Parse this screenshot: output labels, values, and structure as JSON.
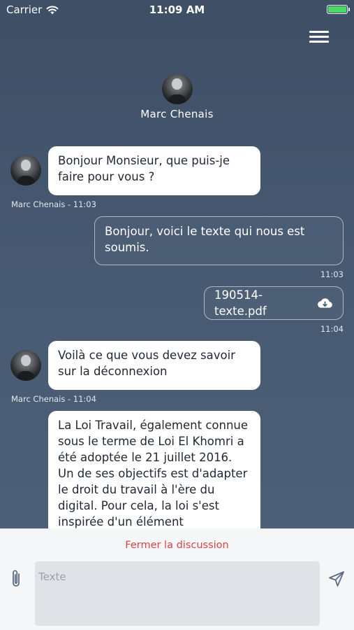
{
  "status_bar": {
    "carrier": "Carrier",
    "time": "11:09 AM"
  },
  "agent": {
    "name": "Marc Chenais"
  },
  "messages": [
    {
      "text": "Bonjour Monsieur, que puis-je faire pour vous ?",
      "meta": "Marc Chenais - 11:03"
    },
    {
      "text": "Bonjour, voici le texte qui nous est soumis.",
      "meta": "11:03"
    },
    {
      "file": "190514-texte.pdf",
      "meta": "11:04"
    },
    {
      "text": "Voilà ce que vous devez savoir sur la déconnexion",
      "meta": "Marc Chenais - 11:04"
    },
    {
      "text": "La Loi Travail, également connue sous le terme de Loi El Khomri a été adoptée le 21 juillet 2016. Un de ses objectifs est d'adapter le droit du travail à l'ère du digital. Pour cela, la loi s'est inspirée d'un élément"
    }
  ],
  "footer": {
    "close_label": "Fermer la discussion",
    "input_placeholder": "Texte"
  },
  "icons": {
    "menu": "hamburger-icon",
    "attach": "paperclip-icon",
    "send": "send-icon",
    "download": "cloud-download-icon"
  },
  "colors": {
    "close_link": "#d64545",
    "battery": "#4cd964"
  }
}
